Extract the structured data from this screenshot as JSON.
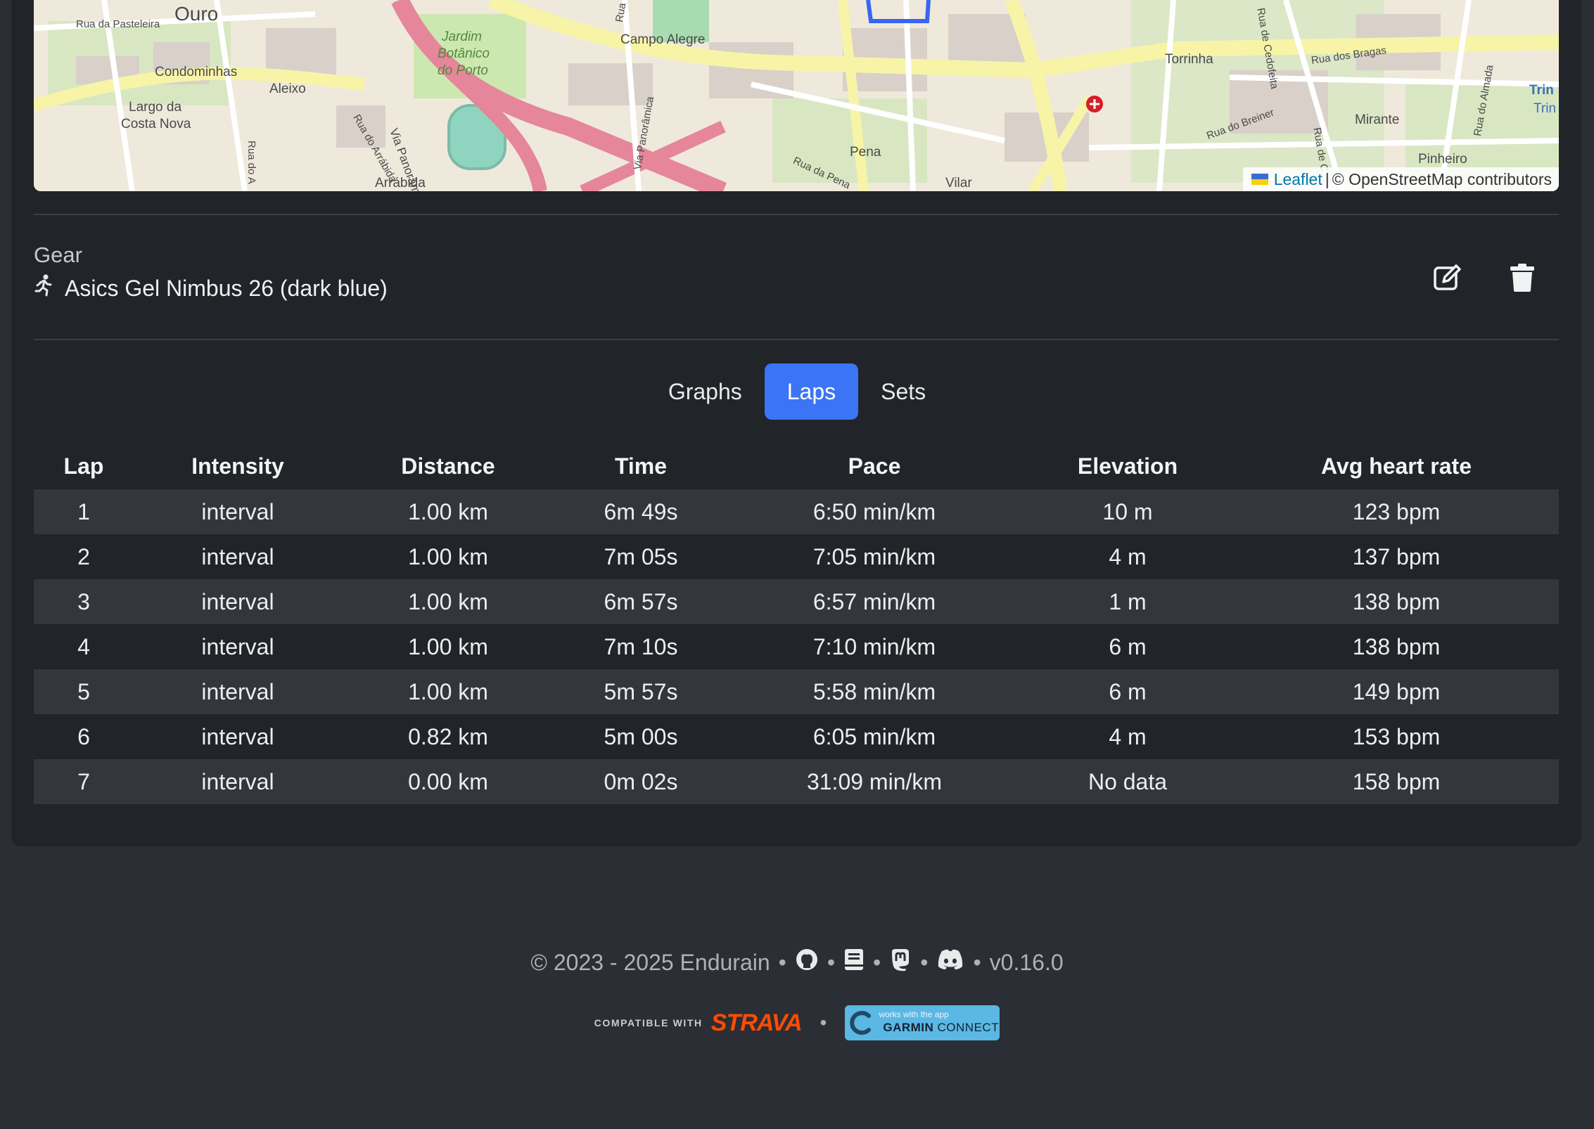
{
  "map": {
    "labels": [
      "Ouro",
      "Rua da Pasteleira",
      "Condominhas",
      "Largo da",
      "Costa Nova",
      "Aleixo",
      "Jardim",
      "Botânico",
      "do Porto",
      "Via Panorâmica",
      "Rua do Arrábida",
      "Arrábida",
      "Rua do A",
      "Campo Alegre",
      "Via Panorâmica",
      "Rua da Pena",
      "Pena",
      "Vilar",
      "Torrinha",
      "Rua de Cedofeita",
      "Rua dos Bragas",
      "Rua do Breiner",
      "Mirante",
      "Pinheiro",
      "Rua do Almada",
      "Rua de C",
      "Trin",
      "Trin",
      "Rua"
    ],
    "attribution": {
      "leaflet": "Leaflet",
      "separator": "|",
      "osm": "© OpenStreetMap contributors"
    }
  },
  "gear": {
    "title": "Gear",
    "name": "Asics Gel Nimbus 26 (dark blue)",
    "icons": {
      "type": "running-icon",
      "edit": "edit-icon",
      "delete": "trash-icon"
    }
  },
  "tabs": [
    {
      "label": "Graphs",
      "active": false
    },
    {
      "label": "Laps",
      "active": true
    },
    {
      "label": "Sets",
      "active": false
    }
  ],
  "laps": {
    "columns": [
      "Lap",
      "Intensity",
      "Distance",
      "Time",
      "Pace",
      "Elevation",
      "Avg heart rate"
    ],
    "rows": [
      [
        "1",
        "interval",
        "1.00 km",
        "6m 49s",
        "6:50 min/km",
        "10 m",
        "123 bpm"
      ],
      [
        "2",
        "interval",
        "1.00 km",
        "7m 05s",
        "7:05 min/km",
        "4 m",
        "137 bpm"
      ],
      [
        "3",
        "interval",
        "1.00 km",
        "6m 57s",
        "6:57 min/km",
        "1 m",
        "138 bpm"
      ],
      [
        "4",
        "interval",
        "1.00 km",
        "7m 10s",
        "7:10 min/km",
        "6 m",
        "138 bpm"
      ],
      [
        "5",
        "interval",
        "1.00 km",
        "5m 57s",
        "5:58 min/km",
        "6 m",
        "149 bpm"
      ],
      [
        "6",
        "interval",
        "0.82 km",
        "5m 00s",
        "6:05 min/km",
        "4 m",
        "153 bpm"
      ],
      [
        "7",
        "interval",
        "0.00 km",
        "0m 02s",
        "31:09 min/km",
        "No data",
        "158 bpm"
      ]
    ]
  },
  "footer": {
    "copyright": "© 2023 - 2025 Endurain",
    "separator": "•",
    "version": "v0.16.0",
    "icons": [
      "github-icon",
      "docs-icon",
      "mastodon-icon",
      "discord-icon"
    ],
    "strava": {
      "compatible": "COMPATIBLE WITH",
      "logo": "STRAVA"
    },
    "garmin": {
      "small": "works with the app",
      "brand": "GARMIN",
      "product": "CONNECT"
    }
  },
  "colors": {
    "page_bg": "#2b2e34",
    "card_bg": "#212428",
    "accent": "#3b75f6",
    "stripe": "#33363c",
    "strava": "#fc4c02"
  }
}
